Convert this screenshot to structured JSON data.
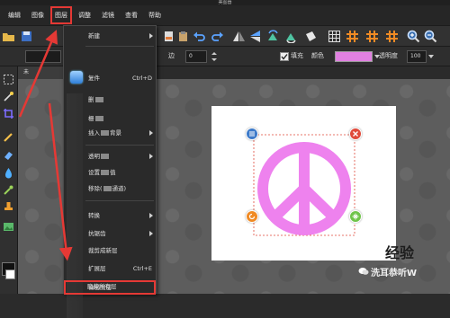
{
  "window": {
    "title": "美图器"
  },
  "menubar": {
    "items": [
      {
        "label": "编辑"
      },
      {
        "label": "图像"
      },
      {
        "label": "图层"
      },
      {
        "label": "调整"
      },
      {
        "label": "滤镜"
      },
      {
        "label": "查看"
      },
      {
        "label": "帮助"
      }
    ],
    "active_index": 2
  },
  "optionsbar": {
    "stroke_label": "边",
    "stroke_value": "0",
    "fill_label": "填充",
    "fill_checked": true,
    "color_label": "颜色",
    "color_value": "#e080e0",
    "opacity_label": "透明度",
    "opacity_value": "100"
  },
  "document": {
    "tab_label": "未"
  },
  "layer_menu": {
    "items": [
      {
        "label": "新建",
        "shortcut": "",
        "submenu": true
      },
      {
        "label": "复件",
        "shortcut": "Ctrl+D",
        "submenu": false
      },
      {
        "label": "删",
        "shortcut": "",
        "submenu": false
      },
      {
        "label": "栅",
        "shortcut": "",
        "submenu": false
      },
      {
        "label_start": "插入",
        "label_end": "背景",
        "shortcut": "",
        "submenu": true
      },
      {
        "label_start": "透明",
        "label_end": "",
        "shortcut": "",
        "submenu": true
      },
      {
        "label_start": "设置",
        "label_end": "值",
        "shortcut": "",
        "submenu": false
      },
      {
        "label_start": "移除(",
        "label_end": "通道)",
        "shortcut": "",
        "submenu": false
      },
      {
        "label": "转换",
        "shortcut": "",
        "submenu": true
      },
      {
        "label": "抗锯齿",
        "shortcut": "",
        "submenu": true
      },
      {
        "label": "裁剪成新层",
        "shortcut": "",
        "submenu": false
      },
      {
        "label": "扩展层",
        "shortcut": "Ctrl+E",
        "submenu": false
      },
      {
        "label": "输出图层",
        "shortcut": "",
        "submenu": false
      },
      {
        "label": "隐藏所有层",
        "shortcut": "",
        "submenu": false
      }
    ],
    "highlighted_label": "输出图层"
  },
  "shape": {
    "type": "peace-sign",
    "color": "#ee82ee"
  },
  "watermark": {
    "text": "洗耳恭听W",
    "brand": "经验"
  },
  "colors": {
    "accent": "#e53935",
    "workspace": "#5d5d5d"
  },
  "icons": [
    "folder-open-icon",
    "save-icon",
    "undo-icon",
    "redo-icon",
    "flip-horizontal-icon",
    "flip-vertical-icon",
    "rotate-icon",
    "grid-icon",
    "zoom-in-icon",
    "zoom-out-icon",
    "rect-select-icon",
    "magic-wand-icon",
    "crop-icon",
    "brush-icon",
    "eraser-icon",
    "drop-icon",
    "eyedropper-icon",
    "stamp-icon",
    "image-icon",
    "menu-handle-icon",
    "close-handle-icon",
    "rotate-handle-icon",
    "move-handle-icon",
    "wechat-icon"
  ]
}
